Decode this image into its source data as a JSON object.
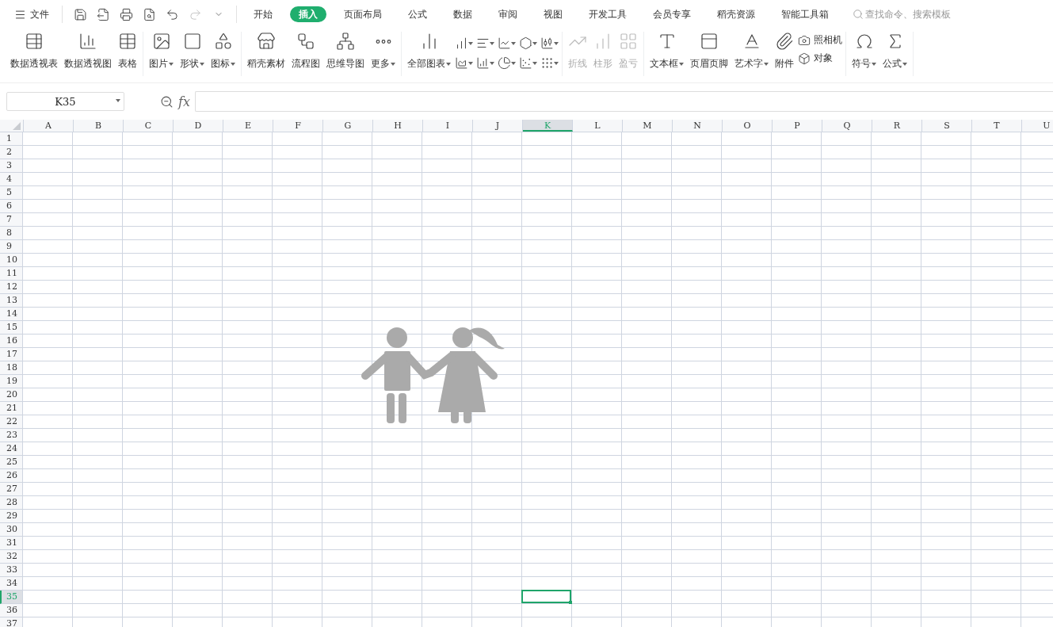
{
  "menu_bar": {
    "file_label": "文件",
    "quick_access": [
      {
        "disabled": false
      },
      {
        "disabled": false
      },
      {
        "disabled": false
      },
      {
        "disabled": false
      },
      {
        "disabled": false
      },
      {
        "disabled": true
      },
      {
        "disabled": false
      }
    ],
    "tabs": [
      {
        "label": "开始",
        "selected": false
      },
      {
        "label": "插入",
        "selected": true
      },
      {
        "label": "页面布局",
        "selected": false
      },
      {
        "label": "公式",
        "selected": false
      },
      {
        "label": "数据",
        "selected": false
      },
      {
        "label": "审阅",
        "selected": false
      },
      {
        "label": "视图",
        "selected": false
      },
      {
        "label": "开发工具",
        "selected": false
      },
      {
        "label": "会员专享",
        "selected": false
      },
      {
        "label": "稻壳资源",
        "selected": false
      },
      {
        "label": "智能工具箱",
        "selected": false
      }
    ],
    "search": {
      "placeholder": "查找命令、搜索模板"
    }
  },
  "ribbon": {
    "groups": [
      {
        "items": [
          {
            "kind": "large",
            "label": "数据透视表",
            "dropdown": false,
            "disabled": false
          },
          {
            "kind": "large",
            "label": "数据透视图",
            "dropdown": false,
            "disabled": false
          },
          {
            "kind": "large",
            "label": "表格",
            "dropdown": false,
            "disabled": false
          }
        ]
      },
      {
        "items": [
          {
            "kind": "large",
            "label": "图片",
            "dropdown": true,
            "disabled": false
          },
          {
            "kind": "large",
            "label": "形状",
            "dropdown": true,
            "disabled": false
          },
          {
            "kind": "large",
            "label": "图标",
            "dropdown": true,
            "disabled": false
          }
        ]
      },
      {
        "items": [
          {
            "kind": "large",
            "label": "稻壳素材",
            "dropdown": false,
            "disabled": false
          },
          {
            "kind": "large",
            "label": "流程图",
            "dropdown": false,
            "disabled": false
          },
          {
            "kind": "large",
            "label": "思维导图",
            "dropdown": false,
            "disabled": false
          },
          {
            "kind": "large",
            "label": "更多",
            "dropdown": true,
            "disabled": false
          }
        ]
      },
      {
        "items": [
          {
            "kind": "large",
            "label": "全部图表",
            "dropdown": true,
            "disabled": false
          },
          {
            "kind": "icons",
            "dropdown": true,
            "disabled": false
          },
          {
            "kind": "icons",
            "dropdown": true,
            "disabled": false
          },
          {
            "kind": "icons",
            "dropdown": true,
            "disabled": false
          },
          {
            "kind": "icons",
            "dropdown": true,
            "disabled": false
          },
          {
            "kind": "icons",
            "dropdown": true,
            "disabled": false
          },
          {
            "kind": "icons",
            "dropdown": true,
            "disabled": false
          },
          {
            "kind": "icons",
            "dropdown": true,
            "disabled": false
          },
          {
            "kind": "icons",
            "dropdown": true,
            "disabled": false
          },
          {
            "kind": "icons",
            "dropdown": true,
            "disabled": false
          },
          {
            "kind": "icons",
            "dropdown": true,
            "disabled": false
          }
        ]
      },
      {
        "items": [
          {
            "kind": "large",
            "label": "折线",
            "dropdown": false,
            "disabled": true
          },
          {
            "kind": "large",
            "label": "柱形",
            "dropdown": false,
            "disabled": true
          },
          {
            "kind": "large",
            "label": "盈亏",
            "dropdown": false,
            "disabled": true
          }
        ]
      },
      {
        "items": [
          {
            "kind": "large",
            "label": "文本框",
            "dropdown": true,
            "disabled": false
          },
          {
            "kind": "large",
            "label": "页眉页脚",
            "dropdown": false,
            "disabled": false
          },
          {
            "kind": "large",
            "label": "艺术字",
            "dropdown": true,
            "disabled": false
          },
          {
            "kind": "large",
            "label": "附件",
            "dropdown": false,
            "disabled": false
          },
          {
            "kind": "small",
            "label": "照相机",
            "dropdown": false,
            "disabled": false
          },
          {
            "kind": "small",
            "label": "对象",
            "dropdown": false,
            "disabled": false
          }
        ]
      },
      {
        "items": [
          {
            "kind": "large",
            "label": "符号",
            "dropdown": true,
            "disabled": false
          },
          {
            "kind": "large",
            "label": "公式",
            "dropdown": true,
            "disabled": false
          }
        ]
      }
    ]
  },
  "name_box": {
    "value": "K35"
  },
  "formula_bar": {
    "fx_label": "fx"
  },
  "sheet": {
    "columns": [
      {
        "label": "A",
        "selected": false
      },
      {
        "label": "B",
        "selected": false
      },
      {
        "label": "C",
        "selected": false
      },
      {
        "label": "D",
        "selected": false
      },
      {
        "label": "E",
        "selected": false
      },
      {
        "label": "F",
        "selected": false
      },
      {
        "label": "G",
        "selected": false
      },
      {
        "label": "H",
        "selected": false
      },
      {
        "label": "I",
        "selected": false
      },
      {
        "label": "J",
        "selected": false
      },
      {
        "label": "K",
        "selected": true
      },
      {
        "label": "L",
        "selected": false
      },
      {
        "label": "M",
        "selected": false
      },
      {
        "label": "N",
        "selected": false
      },
      {
        "label": "O",
        "selected": false
      },
      {
        "label": "P",
        "selected": false
      },
      {
        "label": "Q",
        "selected": false
      },
      {
        "label": "R",
        "selected": false
      },
      {
        "label": "S",
        "selected": false
      },
      {
        "label": "T",
        "selected": false
      },
      {
        "label": "U",
        "selected": false
      }
    ],
    "rows": [
      {
        "label": "1",
        "selected": false
      },
      {
        "label": "2",
        "selected": false
      },
      {
        "label": "3",
        "selected": false
      },
      {
        "label": "4",
        "selected": false
      },
      {
        "label": "5",
        "selected": false
      },
      {
        "label": "6",
        "selected": false
      },
      {
        "label": "7",
        "selected": false
      },
      {
        "label": "8",
        "selected": false
      },
      {
        "label": "9",
        "selected": false
      },
      {
        "label": "10",
        "selected": false
      },
      {
        "label": "11",
        "selected": false
      },
      {
        "label": "12",
        "selected": false
      },
      {
        "label": "13",
        "selected": false
      },
      {
        "label": "14",
        "selected": false
      },
      {
        "label": "15",
        "selected": false
      },
      {
        "label": "16",
        "selected": false
      },
      {
        "label": "17",
        "selected": false
      },
      {
        "label": "18",
        "selected": false
      },
      {
        "label": "19",
        "selected": false
      },
      {
        "label": "20",
        "selected": false
      },
      {
        "label": "21",
        "selected": false
      },
      {
        "label": "22",
        "selected": false
      },
      {
        "label": "23",
        "selected": false
      },
      {
        "label": "24",
        "selected": false
      },
      {
        "label": "25",
        "selected": false
      },
      {
        "label": "26",
        "selected": false
      },
      {
        "label": "27",
        "selected": false
      },
      {
        "label": "28",
        "selected": false
      },
      {
        "label": "29",
        "selected": false
      },
      {
        "label": "30",
        "selected": false
      },
      {
        "label": "31",
        "selected": false
      },
      {
        "label": "32",
        "selected": false
      },
      {
        "label": "33",
        "selected": false
      },
      {
        "label": "34",
        "selected": false
      },
      {
        "label": "35",
        "selected": true
      },
      {
        "label": "36",
        "selected": false
      },
      {
        "label": "37",
        "selected": false
      }
    ]
  }
}
